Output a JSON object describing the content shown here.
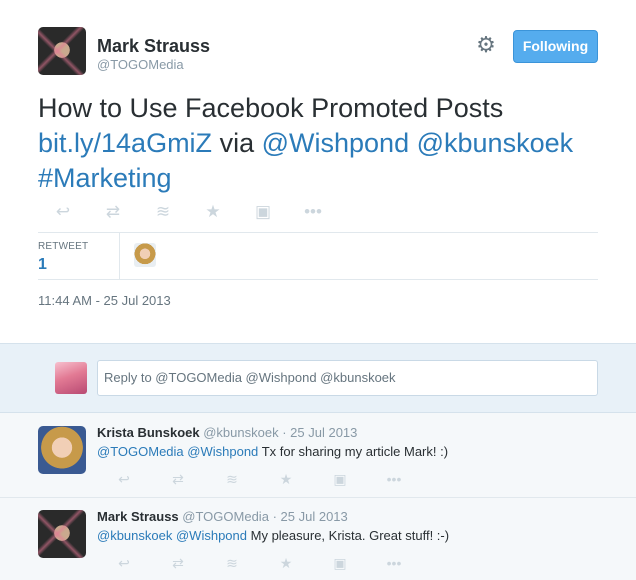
{
  "tweet": {
    "author_name": "Mark Strauss",
    "author_handle": "@TOGOMedia",
    "follow_label": "Following",
    "text_line1": "How to Use Facebook Promoted Posts",
    "link_url": "bit.ly/14aGmiZ",
    "via": "via",
    "mention1": "@Wishpond",
    "mention2": "@kbunskoek",
    "hashtag": "#Marketing",
    "retweet_label": "RETWEET",
    "retweet_count": "1",
    "timestamp": "11:44 AM - 25 Jul 2013"
  },
  "actions": [
    {
      "icon": "reply-icon",
      "glyph": "↩"
    },
    {
      "icon": "retweet-icon",
      "glyph": "⇄"
    },
    {
      "icon": "stack-icon",
      "glyph": "≋"
    },
    {
      "icon": "star-icon",
      "glyph": "★"
    },
    {
      "icon": "media-icon",
      "glyph": "▣"
    },
    {
      "icon": "more-icon",
      "glyph": "•••"
    }
  ],
  "reply_box": {
    "placeholder": "Reply to @TOGOMedia @Wishpond @kbunskoek"
  },
  "replies": [
    {
      "name": "Krista Bunskoek",
      "handle": "@kbunskoek",
      "date": "25 Jul 2013",
      "mention1": "@TOGOMedia",
      "mention2": "@Wishpond",
      "text": "Tx for sharing my article Mark! :)"
    },
    {
      "name": "Mark Strauss",
      "handle": "@TOGOMedia",
      "date": "25 Jul 2013",
      "mention1": "@kbunskoek",
      "mention2": "@Wishpond",
      "text": "My pleasure, Krista. Great stuff! :-)"
    }
  ],
  "colors": {
    "link": "#2b7bb9",
    "follow_button": "#55acee",
    "reply_area": "#e8f1f8"
  }
}
